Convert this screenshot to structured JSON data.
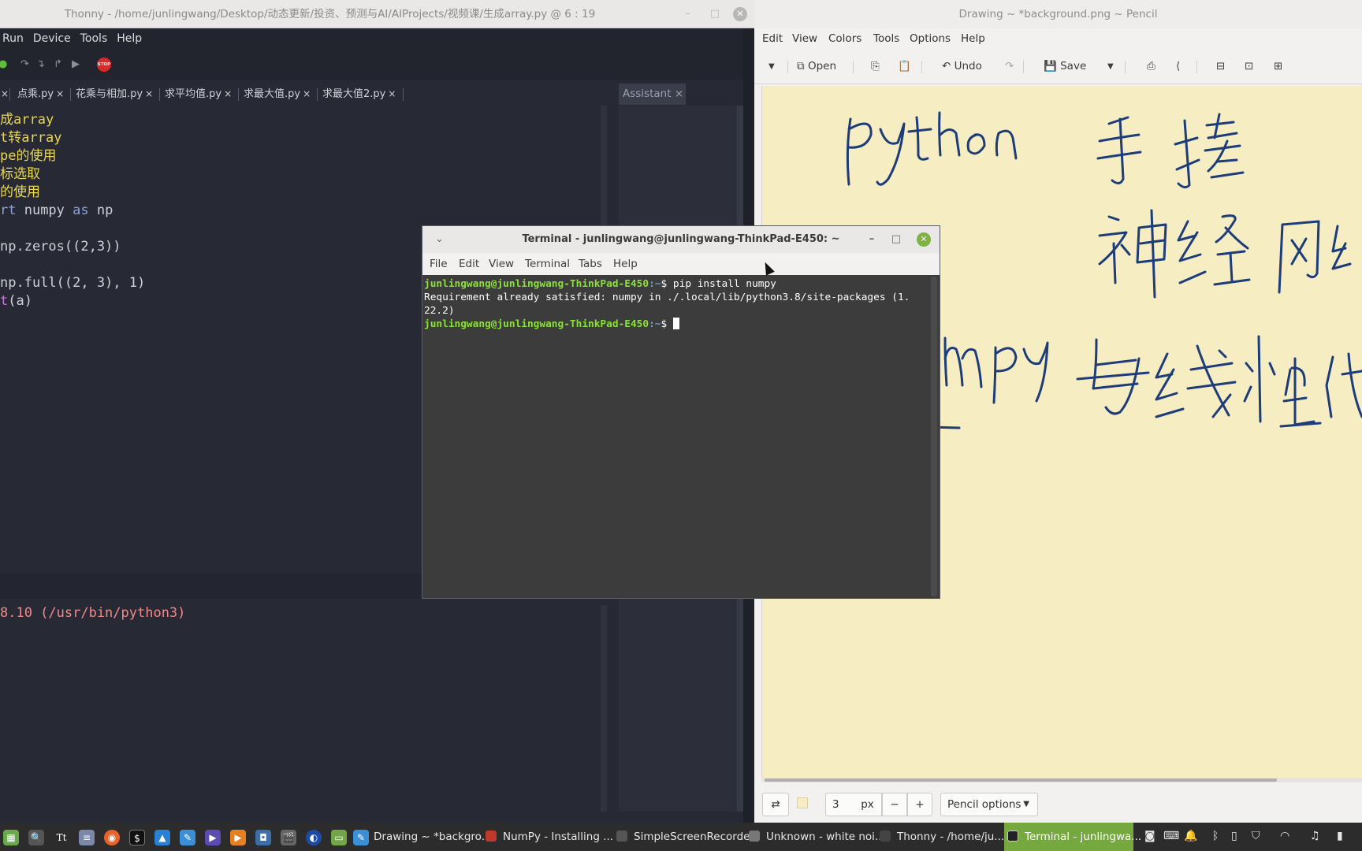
{
  "thonny": {
    "title": "Thonny  -  /home/junlingwang/Desktop/动态更新/投资、预测与AI/AIProjects/视频课/生成array.py  @  6 : 19",
    "menu": [
      "Run",
      "Device",
      "Tools",
      "Help"
    ],
    "tabs": [
      "点乘.py",
      "花乘与相加.py",
      "求平均值.py",
      "求最大值.py",
      "求最大值2.py"
    ],
    "tab_close": "×",
    "code_lines": [
      {
        "segments": [
          {
            "t": "成array",
            "c": "comment"
          }
        ]
      },
      {
        "segments": [
          {
            "t": "t转array",
            "c": "comment"
          }
        ]
      },
      {
        "segments": [
          {
            "t": "pe的使用",
            "c": "comment"
          }
        ]
      },
      {
        "segments": [
          {
            "t": "标选取",
            "c": "comment"
          }
        ]
      },
      {
        "segments": [
          {
            "t": "的使用",
            "c": "comment"
          }
        ]
      },
      {
        "segments": [
          {
            "t": "rt",
            "c": "kw"
          },
          {
            "t": " numpy ",
            "c": "plain"
          },
          {
            "t": "as",
            "c": "kw"
          },
          {
            "t": " np",
            "c": "plain"
          }
        ]
      },
      {
        "segments": []
      },
      {
        "segments": [
          {
            "t": "np.zeros((2,3))",
            "c": "plain"
          }
        ]
      },
      {
        "segments": []
      },
      {
        "segments": [
          {
            "t": "np.full((2, 3), 1)",
            "c": "plain"
          }
        ]
      },
      {
        "segments": [
          {
            "t": "t",
            "c": "builtin"
          },
          {
            "t": "(a)",
            "c": "plain"
          }
        ]
      }
    ],
    "shell_line": "8.10 (/usr/bin/python3)",
    "assistant_tab": "Assistant",
    "stop_label": "STOP"
  },
  "pencil": {
    "title": "Drawing ~ *background.png ~ Pencil",
    "menu": [
      "Edit",
      "View",
      "Colors",
      "Tools",
      "Options",
      "Help"
    ],
    "toolbar": {
      "open": "Open",
      "undo": "Undo",
      "save": "Save"
    },
    "bottom": {
      "size": "3",
      "unit": "px",
      "minus": "−",
      "plus": "+",
      "options": "Pencil options"
    },
    "handwriting": [
      "python 手搓",
      "神经网络",
      "numpy 与线性代数"
    ]
  },
  "terminal": {
    "title": "Terminal - junlingwang@junlingwang-ThinkPad-E450: ~",
    "menu": [
      "File",
      "Edit",
      "View",
      "Terminal",
      "Tabs",
      "Help"
    ],
    "prompt_user": "junlingwang@junlingwang-ThinkPad-E450",
    "prompt_path": ":~",
    "prompt_symbol": "$ ",
    "command": "pip install numpy",
    "output_1": "Requirement already satisfied: numpy in ./.local/lib/python3.8/site-packages (1.",
    "output_2": "22.2)"
  },
  "taskbar": {
    "tasks": [
      {
        "label": "Drawing ~ *backgro...",
        "active": false,
        "color": "#3a7bd5"
      },
      {
        "label": "NumPy - Installing ...",
        "active": false,
        "color": "#c0392b"
      },
      {
        "label": "SimpleScreenRecorder",
        "active": false,
        "color": "#555555"
      },
      {
        "label": "Unknown - white noi...",
        "active": false,
        "color": "#777777"
      },
      {
        "label": "Thonny - /home/ju...",
        "active": false,
        "color": "#444444"
      },
      {
        "label": "Terminal - junlingwa...",
        "active": true,
        "color": "#222222"
      }
    ]
  },
  "colors": {
    "editor_bg": "#272a35",
    "comment": "#e8d74c",
    "keyword": "#8fa1d9",
    "canvas": "#f7edc3",
    "ink": "#1d3d7a",
    "prompt_green": "#8ae234",
    "active_task": "#75a83e"
  }
}
